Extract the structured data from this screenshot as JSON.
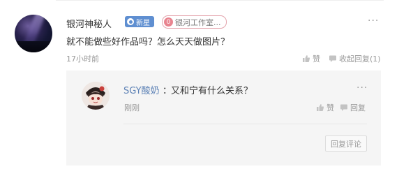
{
  "comment": {
    "username": "银河神秘人",
    "badge_new": "新星",
    "badge_studio_prefix": "0",
    "badge_studio": "银河工作室...",
    "text": "就不能做些好作品吗？怎么天天做图片？",
    "time": "17小时前",
    "like_label": "赞",
    "collapse_reply_label": "收起回复(1)",
    "more_icon": "ellipsis-icon"
  },
  "reply": {
    "username": "SGY酸奶",
    "colon": "：",
    "text": "又和宁有什么关系？",
    "time": "刚刚",
    "like_label": "赞",
    "reply_label": "回复",
    "more_icon": "ellipsis-icon"
  },
  "reply_comment_button": "回复评论",
  "colors": {
    "accent": "#5b80b5",
    "new_badge": "#5f8fd1",
    "studio_badge": "#e8848f"
  }
}
